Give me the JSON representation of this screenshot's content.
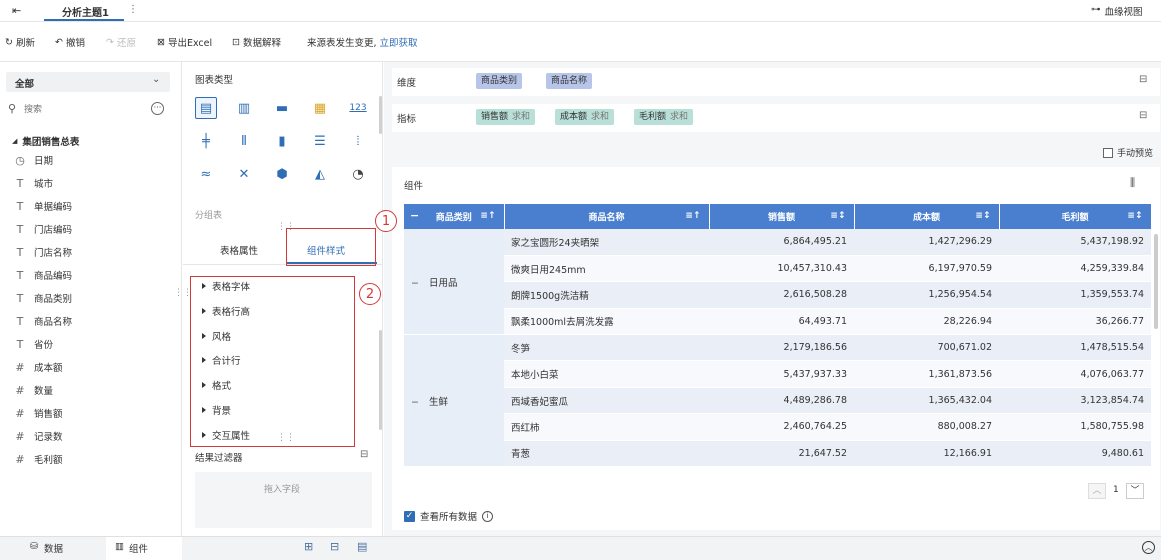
{
  "topbar": {
    "title": "分析主题1",
    "lineage_label": "血缘视图"
  },
  "toolbar": {
    "refresh": "刷新",
    "undo": "撤销",
    "redo": "还原",
    "export_excel": "导出Excel",
    "data_explain": "数据解释",
    "notice": "来源表发生变更,",
    "notice_link": "立即获取"
  },
  "leftpanel": {
    "scope": "全部",
    "search_placeholder": "搜索",
    "table_name": "集团销售总表",
    "fields": [
      {
        "icon": "◷",
        "type": "date",
        "name": "日期"
      },
      {
        "icon": "T",
        "type": "text",
        "name": "城市"
      },
      {
        "icon": "T",
        "type": "text",
        "name": "单据编码"
      },
      {
        "icon": "T",
        "type": "text",
        "name": "门店编码"
      },
      {
        "icon": "T",
        "type": "text",
        "name": "门店名称"
      },
      {
        "icon": "T",
        "type": "text",
        "name": "商品编码"
      },
      {
        "icon": "T",
        "type": "text",
        "name": "商品类别"
      },
      {
        "icon": "T",
        "type": "text",
        "name": "商品名称"
      },
      {
        "icon": "T",
        "type": "text",
        "name": "省份"
      },
      {
        "icon": "#",
        "type": "number",
        "name": "成本额"
      },
      {
        "icon": "#",
        "type": "number",
        "name": "数量"
      },
      {
        "icon": "#",
        "type": "number",
        "name": "销售额"
      },
      {
        "icon": "#",
        "type": "count",
        "name": "记录数"
      },
      {
        "icon": "#",
        "type": "calc",
        "name": "毛利额"
      }
    ]
  },
  "midpanel": {
    "chart_type_label": "图表类型",
    "group_table_label": "分组表",
    "tab_table_props": "表格属性",
    "tab_component_style": "组件样式",
    "style_items": [
      "表格字体",
      "表格行高",
      "风格",
      "合计行",
      "格式",
      "背景",
      "交互属性"
    ],
    "result_filter_label": "结果过滤器",
    "drop_field_hint": "拖入字段"
  },
  "rightpanel": {
    "dimension_label": "维度",
    "dimensions": [
      "商品类别",
      "商品名称"
    ],
    "measure_label": "指标",
    "measures": [
      {
        "name": "销售额",
        "agg": "求和"
      },
      {
        "name": "成本额",
        "agg": "求和"
      },
      {
        "name": "毛利额",
        "agg": "求和"
      }
    ],
    "manual_preview": "手动预览",
    "component_label": "组件",
    "columns": [
      "商品类别",
      "商品名称",
      "销售额",
      "成本额",
      "毛利额"
    ],
    "groups": [
      {
        "category": "日用品",
        "rows": [
          [
            "家之宝圆形24夹晒架",
            "6,864,495.21",
            "1,427,296.29",
            "5,437,198.92"
          ],
          [
            "微爽日用245mm",
            "10,457,310.43",
            "6,197,970.59",
            "4,259,339.84"
          ],
          [
            "朗牌1500g洗洁精",
            "2,616,508.28",
            "1,256,954.54",
            "1,359,553.74"
          ],
          [
            "飘柔1000ml去屑洗发露",
            "64,493.71",
            "28,226.94",
            "36,266.77"
          ]
        ]
      },
      {
        "category": "生鲜",
        "rows": [
          [
            "冬笋",
            "2,179,186.56",
            "700,671.02",
            "1,478,515.54"
          ],
          [
            "本地小白菜",
            "5,437,937.33",
            "1,361,873.56",
            "4,076,063.77"
          ],
          [
            "西域香妃蜜瓜",
            "4,489,286.78",
            "1,365,432.04",
            "3,123,854.74"
          ],
          [
            "西红柿",
            "2,460,764.25",
            "880,008.27",
            "1,580,755.98"
          ],
          [
            "青葱",
            "21,647.52",
            "12,166.91",
            "9,480.61"
          ]
        ]
      }
    ],
    "page_number": "1",
    "view_all_data": "查看所有数据"
  },
  "bottombar": {
    "tab_data": "数据",
    "tab_component": "组件"
  },
  "annotations": [
    "1",
    "2"
  ],
  "colors": {
    "accent": "#2f6db5",
    "header": "#4a7fd0",
    "highlight": "#d23a3a",
    "dim_tag": "#b6c5e8",
    "measure_tag": "#b8e0d8"
  }
}
